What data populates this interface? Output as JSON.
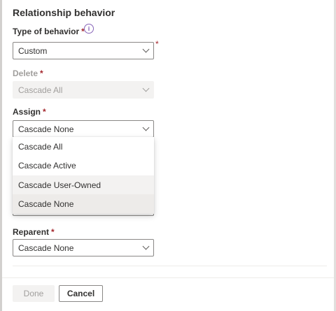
{
  "panel": {
    "title": "Relationship behavior"
  },
  "type_of_behavior": {
    "label": "Type of behavior",
    "required_mark": "*",
    "info_icon_glyph": "i",
    "value": "Custom",
    "outside_required_mark": "*"
  },
  "delete": {
    "label": "Delete",
    "required_mark": "*",
    "value": "Cascade All"
  },
  "assign": {
    "label": "Assign",
    "required_mark": "*",
    "value": "Cascade None",
    "options": [
      "Cascade All",
      "Cascade Active",
      "Cascade User-Owned",
      "Cascade None"
    ]
  },
  "reparent": {
    "label": "Reparent",
    "required_mark": "*",
    "value": "Cascade None"
  },
  "footer": {
    "done_label": "Done",
    "cancel_label": "Cancel"
  },
  "colors": {
    "required": "#a4262c",
    "info_icon": "#8764b8",
    "border": "#8a8886",
    "hover_bg": "#f3f2f1",
    "selected_bg": "#edebe9"
  }
}
